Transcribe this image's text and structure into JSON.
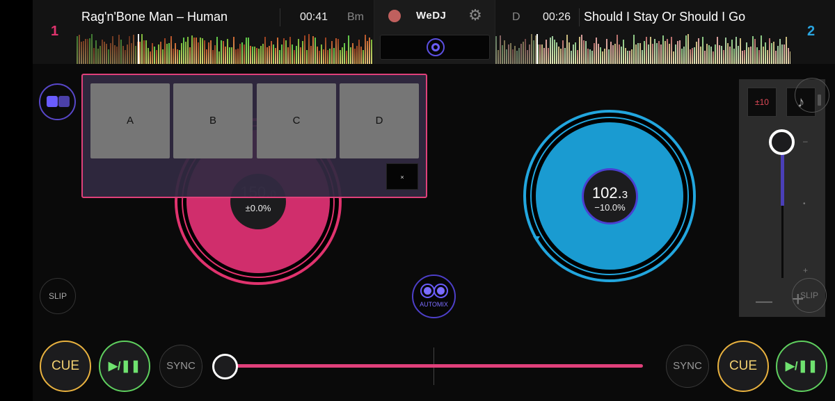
{
  "app": {
    "brand": "WeDJ"
  },
  "deck_left": {
    "number": "1",
    "title": "Rag'n'Bone Man – Human",
    "time": "00:41",
    "key": "Bm",
    "bpm_int": "150.",
    "bpm_dec": "0",
    "pitch": "±0.0%",
    "accent_color": "#e0336e",
    "playhead_fraction": 0.21
  },
  "deck_right": {
    "number": "2",
    "title": "Should I Stay Or Should I Go",
    "time": "00:26",
    "key": "D",
    "bpm_int": "102.",
    "bpm_dec": "3",
    "pitch": "−10.0%",
    "accent_color": "#22a6de",
    "playhead_fraction": 0.12
  },
  "header_center": {
    "record_icon": "record-icon",
    "settings_icon": "gear-icon",
    "gear_glyph": "⚙"
  },
  "hot_cues": {
    "pads": [
      "A",
      "B",
      "C",
      "D"
    ],
    "close_label": "×"
  },
  "buttons": {
    "slip": "SLIP",
    "cue": "CUE",
    "play_pause": "▶/❚❚",
    "sync": "SYNC",
    "automix": "AUTOMIX"
  },
  "crossfader": {
    "position_fraction": 0.0
  },
  "pitch_panel": {
    "range_label": "±10",
    "keylock_glyph": "♪",
    "tick_top": "–",
    "tick_mid": "•",
    "tick_bottom": "+",
    "minus_label": "—",
    "plus_label": "+",
    "pitch_fraction": 0.0
  }
}
